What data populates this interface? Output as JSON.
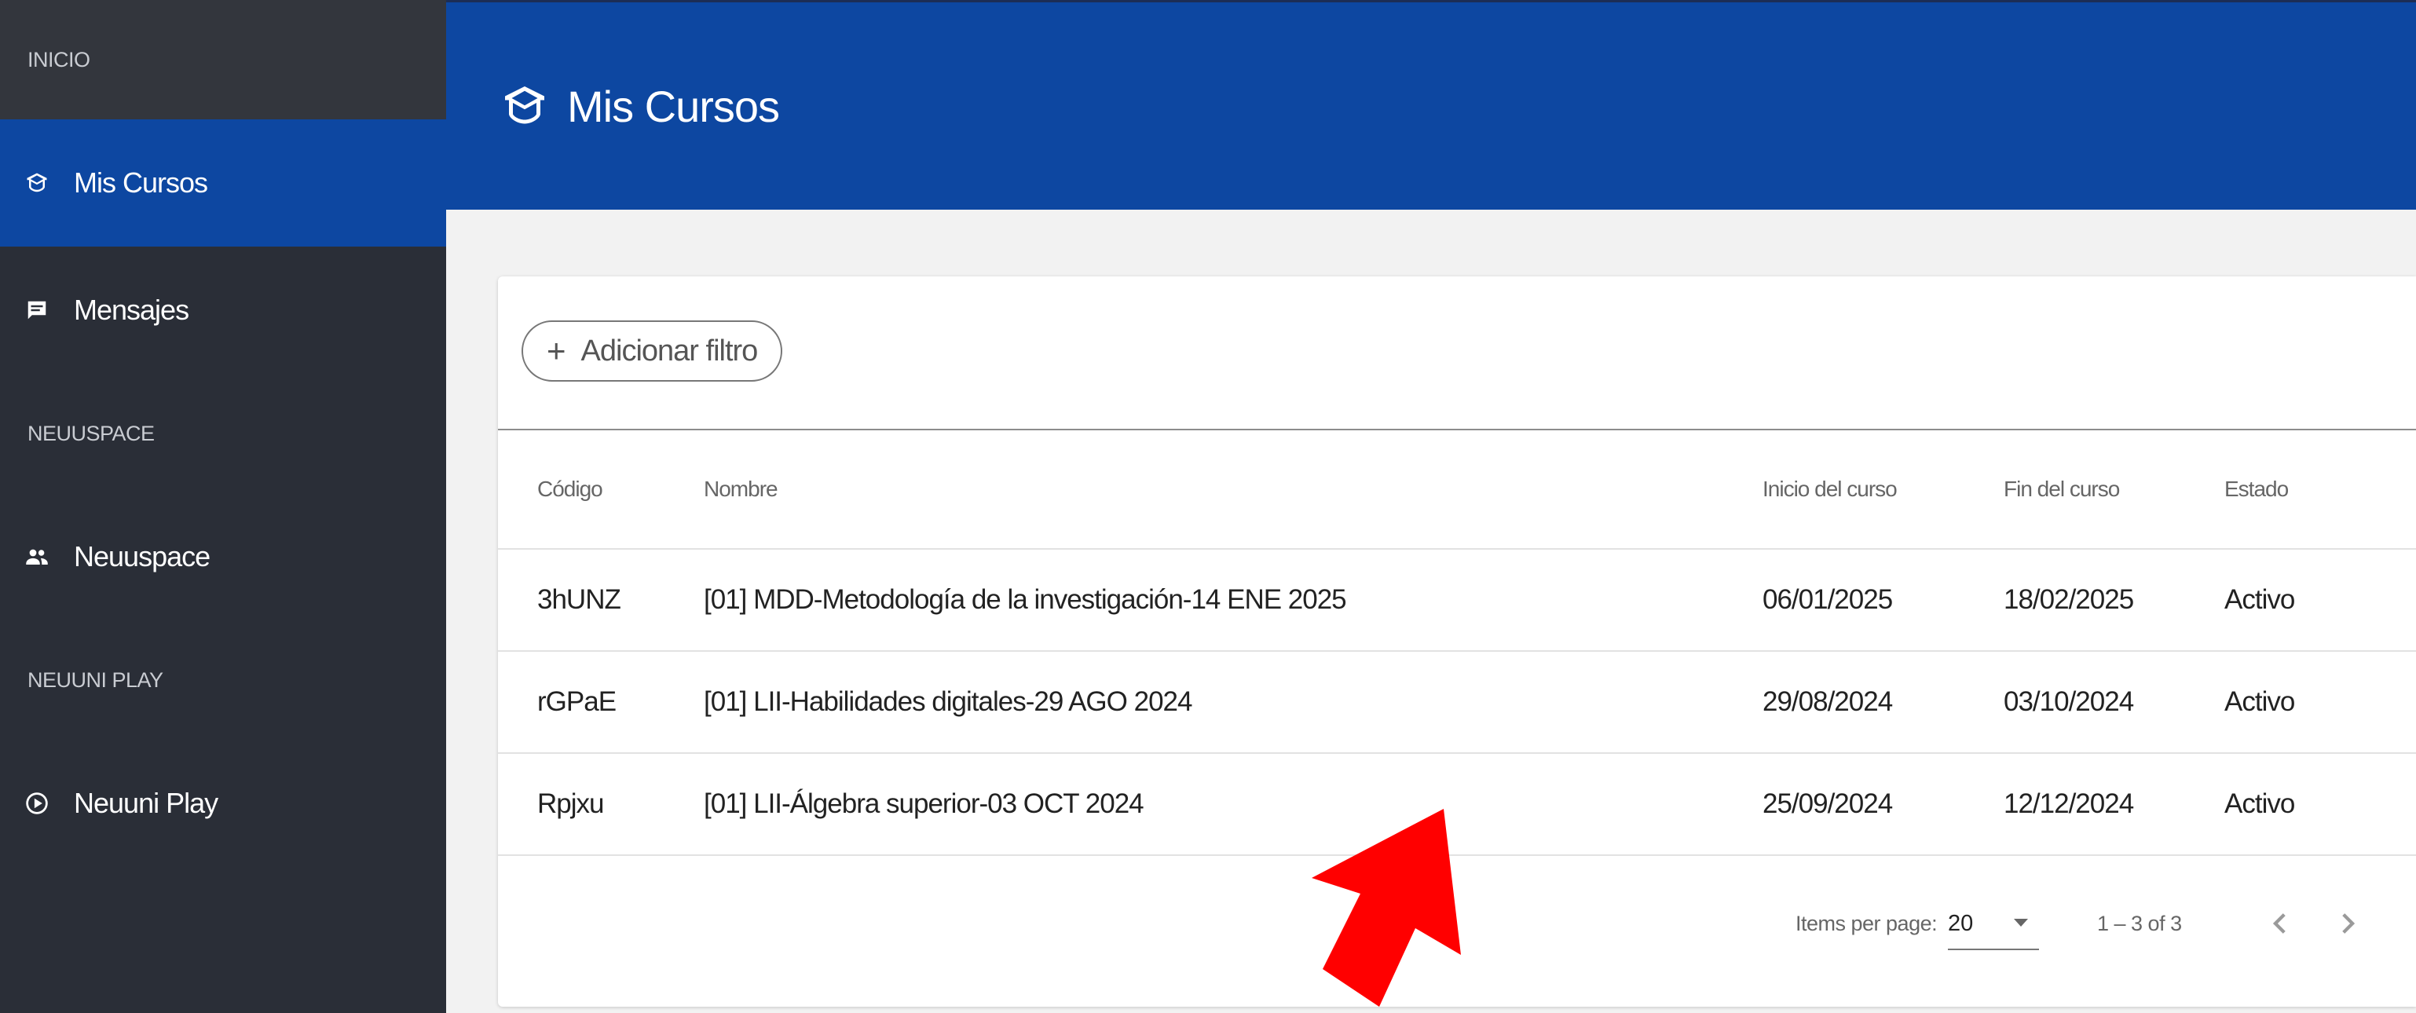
{
  "sidebar": {
    "sections": [
      {
        "label": "INICIO"
      },
      {
        "label": "NEUUSPACE"
      },
      {
        "label": "NEUUNI PLAY"
      }
    ],
    "items": [
      {
        "label": "Mis Cursos",
        "icon": "graduation-cap-icon",
        "active": true
      },
      {
        "label": "Mensajes",
        "icon": "message-icon"
      },
      {
        "label": "Neuuspace",
        "icon": "users-icon"
      },
      {
        "label": "Neuuni Play",
        "icon": "play-globe-icon"
      }
    ]
  },
  "header": {
    "title": "Mis Cursos",
    "icon": "graduation-cap-icon",
    "color": "#0d47a1"
  },
  "filter": {
    "label": "Adicionar filtro",
    "icon": "+"
  },
  "table": {
    "columns": [
      "Código",
      "Nombre",
      "Inicio del curso",
      "Fin del curso",
      "Estado"
    ],
    "rows": [
      {
        "codigo": "3hUNZ",
        "nombre": "[01] MDD-Metodología de la investigación-14 ENE 2025",
        "inicio": "06/01/2025",
        "fin": "18/02/2025",
        "estado": "Activo"
      },
      {
        "codigo": "rGPaE",
        "nombre": "[01] LII-Habilidades digitales-29 AGO 2024",
        "inicio": "29/08/2024",
        "fin": "03/10/2024",
        "estado": "Activo"
      },
      {
        "codigo": "Rpjxu",
        "nombre": "[01] LII-Álgebra superior-03 OCT 2024",
        "inicio": "25/09/2024",
        "fin": "12/12/2024",
        "estado": "Activo"
      }
    ]
  },
  "paginator": {
    "items_per_page_label": "Items per page:",
    "items_per_page_value": "20",
    "range_label": "1 – 3 of 3"
  },
  "colors": {
    "sidebar_bg": "#2a2e37",
    "accent": "#0d47a1",
    "annotation_arrow": "#ff0000"
  }
}
